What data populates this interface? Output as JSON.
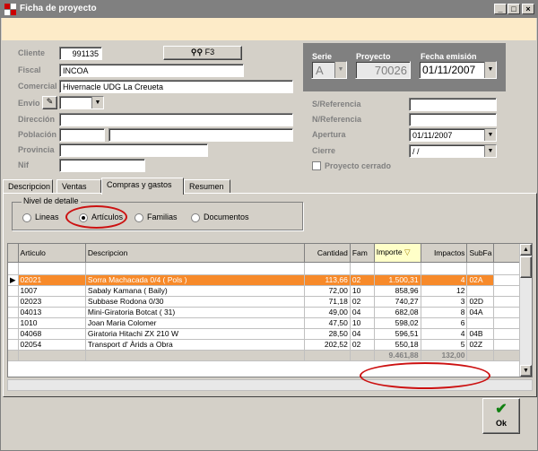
{
  "window": {
    "title": "Ficha de proyecto"
  },
  "header": {
    "cliente_label": "Cliente",
    "cliente_value": "991135",
    "search_button_label": "F3",
    "fiscal_label": "Fiscal",
    "fiscal_value": "INCOA",
    "comercial_label": "Comercial",
    "comercial_value": "Hivernacle UDG La Creueta",
    "envio_label": "Envio",
    "direccion_label": "Dirección",
    "poblacion_label": "Población",
    "provincia_label": "Provincia",
    "nif_label": "Nif",
    "serie_label": "Serie",
    "serie_value": "A",
    "proyecto_label": "Proyecto",
    "proyecto_value": "70026",
    "fecha_emision_label": "Fecha emisión",
    "fecha_emision_value": "01/11/2007",
    "s_referencia_label": "S/Referencia",
    "n_referencia_label": "N/Referencia",
    "apertura_label": "Apertura",
    "apertura_value": "01/11/2007",
    "cierre_label": "Cierre",
    "cierre_value": "/ /",
    "proyecto_cerrado_label": "Proyecto cerrado"
  },
  "tabs": [
    "Descripcion",
    "Ventas",
    "Compras y gastos",
    "Resumen"
  ],
  "detail": {
    "title": "Nivel de detalle",
    "options": [
      "Lineas",
      "Artículos",
      "Familias",
      "Documentos"
    ]
  },
  "grid": {
    "columns": [
      "Articulo",
      "Descripcion",
      "Cantidad",
      "Fam",
      "Importe",
      "Impactos",
      "SubFa"
    ],
    "rows": [
      [
        "02021",
        "Sorra Machacada 0/4 ( Pols )",
        "113,66",
        "02",
        "1.500,31",
        "4",
        "02A"
      ],
      [
        "1007",
        "Sabaly Kamana ( Baily)",
        "72,00",
        "10",
        "858,96",
        "12",
        ""
      ],
      [
        "02023",
        "Subbase Rodona 0/30",
        "71,18",
        "02",
        "740,27",
        "3",
        "02D"
      ],
      [
        "04013",
        "Mini-Giratoria Botcat ( 31)",
        "49,00",
        "04",
        "682,08",
        "8",
        "04A"
      ],
      [
        "1010",
        "Joan Maria Colomer",
        "47,50",
        "10",
        "598,02",
        "6",
        ""
      ],
      [
        "04068",
        "Giratoria Hitachi ZX 210 W",
        "28,50",
        "04",
        "596,51",
        "4",
        "04B"
      ],
      [
        "02054",
        "Transport d' Àrids a Obra",
        "202,52",
        "02",
        "550,18",
        "5",
        "02Z"
      ]
    ],
    "total_importe": "9.461,88",
    "total_impactos": "132,00"
  },
  "footer": {
    "ok_label": "Ok"
  },
  "colors": {
    "selection": "#f78a2a",
    "annotation": "#cc1111",
    "infobar": "#fdebc8"
  }
}
